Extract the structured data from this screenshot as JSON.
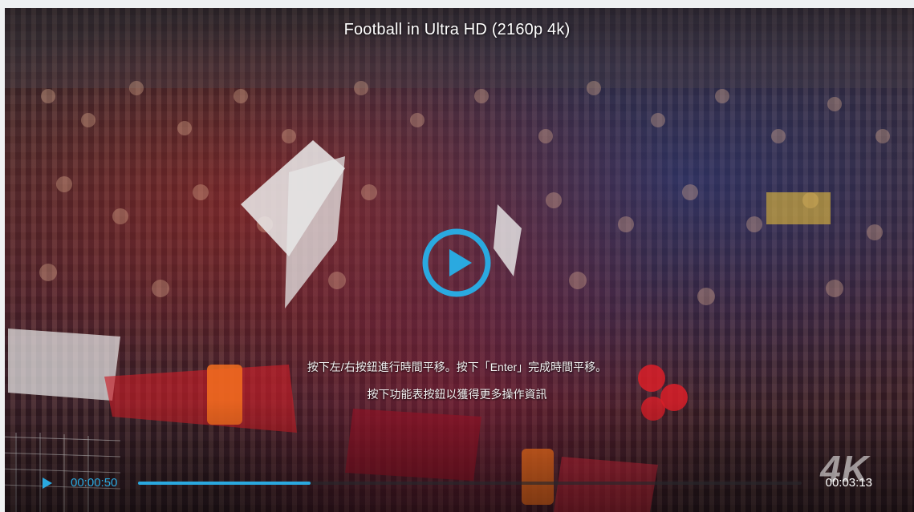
{
  "player": {
    "title": "Football in Ultra HD (2160p 4k)",
    "hint_line_1": "按下左/右按鈕進行時間平移。按下「Enter」完成時間平移。",
    "hint_line_2": "按下功能表按鈕以獲得更多操作資訊",
    "current_time": "00:00:50",
    "total_time": "00:03:13",
    "progress_fraction": 0.26,
    "watermark": "4K",
    "accent_color": "#2aa9e0"
  },
  "icons": {
    "center": "play-circle-icon",
    "control": "play-icon"
  }
}
